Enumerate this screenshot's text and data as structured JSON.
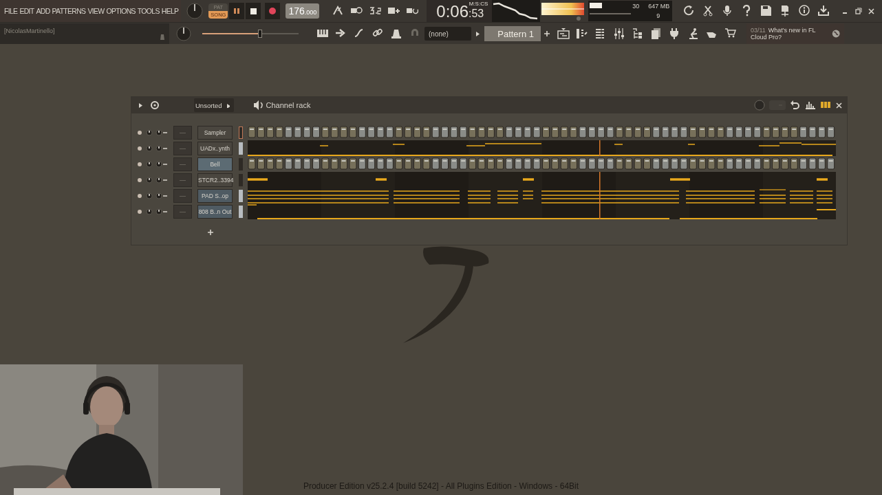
{
  "menu": [
    "FILE",
    "EDIT",
    "ADD",
    "PATTERNS",
    "VIEW",
    "OPTIONS",
    "TOOLS",
    "HELP"
  ],
  "hint_panel": {
    "text": "[NicolasMartinello]"
  },
  "transport": {
    "modes": [
      {
        "label": "PAT",
        "selected": false
      },
      {
        "label": "SONG",
        "selected": true
      }
    ],
    "playing": true,
    "tempo_whole": "176",
    "tempo_fraction": ".000",
    "master_slider": {
      "level": 0.6
    }
  },
  "time": {
    "unit": "M:S:CS",
    "main": "0:06",
    "sub": ":53"
  },
  "cpu": {
    "value": "30",
    "memory": "647 MB",
    "polyphony": "9"
  },
  "pattern": {
    "midi_device": "(none)",
    "name": "Pattern 1"
  },
  "news": {
    "date": "03/11",
    "text": "What's new in FL Cloud Pro?"
  },
  "rack": {
    "filter": "Unsorted",
    "title": "Channel rack",
    "channels": [
      {
        "name": "Sampler",
        "insert": "—",
        "kind": "steps",
        "color": "#4a463f",
        "selected": false,
        "focused": true
      },
      {
        "name": "UADx..ynth",
        "insert": "—",
        "kind": "notes",
        "color": "#4a463f",
        "selected": true,
        "focused": false
      },
      {
        "name": "Bell",
        "insert": "—",
        "kind": "steps",
        "color": "#5c6b73",
        "selected": false,
        "focused": false
      },
      {
        "name": "STCR2..3394",
        "insert": "—",
        "kind": "notes",
        "color": "#4a463f",
        "selected": false,
        "focused": false
      },
      {
        "name": "PAD S..op",
        "insert": "—",
        "kind": "notes",
        "color": "#4f5b63",
        "selected": true,
        "focused": false
      },
      {
        "name": "808 B..n Out",
        "insert": "—",
        "kind": "notes",
        "color": "#4f5b63",
        "selected": true,
        "focused": false
      }
    ]
  },
  "footer": "Producer Edition v25.2.4 [build 5242] - All Plugins Edition - Windows - 64Bit"
}
